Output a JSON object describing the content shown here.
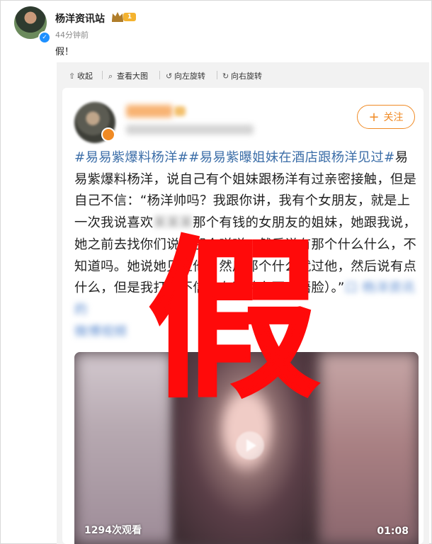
{
  "post": {
    "author": "杨洋资讯站",
    "level": "1",
    "time": "44分钟前",
    "text": "假！"
  },
  "toolbar": {
    "collapse": "收起",
    "view_large": "查看大图",
    "rotate_left": "向左旋转",
    "rotate_right": "向右旋转"
  },
  "card": {
    "follow": "关注",
    "hashtags": "#易易紫爆料杨洋##易易紫曝姐妹在酒店跟杨洋见过#",
    "p1": "易易紫爆料杨洋，说自己有个姐妹跟杨洋有过亲密接触，但是自己不信：“杨洋帅吗？我跟你讲，我有个女朋友，就是上一次我说喜欢",
    "blur1": "某某某",
    "p2": "那个有钱的女朋友的姐妹，她跟我说，她之前去找你们说的那个咩咩，然后说有那个什么什么，不知道吗。她说她见过他，然后那个什么就过他，然后说有点什么，但是我打死不信他有这种东西（捂脸）。”",
    "blur_link": "口 杨洋资讯的",
    "blur_link2": "微博视频"
  },
  "video": {
    "views": "1294次观看",
    "duration": "01:08"
  },
  "overlay": {
    "stamp": "假"
  }
}
